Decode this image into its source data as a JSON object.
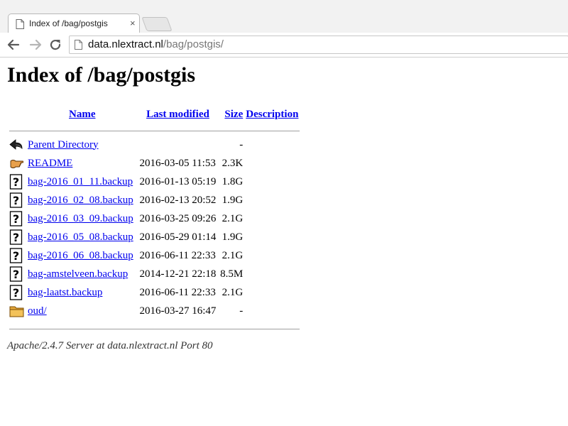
{
  "browser": {
    "tab_title": "Index of /bag/postgis",
    "tab_close": "×",
    "url_host": "data.nlextract.nl",
    "url_path": "/bag/postgis/"
  },
  "page": {
    "heading": "Index of /bag/postgis",
    "columns": {
      "name": "Name",
      "last_modified": "Last modified",
      "size": "Size",
      "description": "Description"
    },
    "entries": [
      {
        "icon": "back-icon",
        "name": "Parent Directory",
        "modified": "",
        "size": "-"
      },
      {
        "icon": "hand-icon",
        "name": "README",
        "modified": "2016-03-05 11:53",
        "size": "2.3K"
      },
      {
        "icon": "unknown-file-icon",
        "name": "bag-2016_01_11.backup",
        "modified": "2016-01-13 05:19",
        "size": "1.8G"
      },
      {
        "icon": "unknown-file-icon",
        "name": "bag-2016_02_08.backup",
        "modified": "2016-02-13 20:52",
        "size": "1.9G"
      },
      {
        "icon": "unknown-file-icon",
        "name": "bag-2016_03_09.backup",
        "modified": "2016-03-25 09:26",
        "size": "2.1G"
      },
      {
        "icon": "unknown-file-icon",
        "name": "bag-2016_05_08.backup",
        "modified": "2016-05-29 01:14",
        "size": "1.9G"
      },
      {
        "icon": "unknown-file-icon",
        "name": "bag-2016_06_08.backup",
        "modified": "2016-06-11 22:33",
        "size": "2.1G"
      },
      {
        "icon": "unknown-file-icon",
        "name": "bag-amstelveen.backup",
        "modified": "2014-12-21 22:18",
        "size": "8.5M"
      },
      {
        "icon": "unknown-file-icon",
        "name": "bag-laatst.backup",
        "modified": "2016-06-11 22:33",
        "size": "2.1G"
      },
      {
        "icon": "folder-icon",
        "name": "oud/",
        "modified": "2016-03-27 16:47",
        "size": "-"
      }
    ],
    "footer": "Apache/2.4.7 Server at data.nlextract.nl Port 80"
  }
}
